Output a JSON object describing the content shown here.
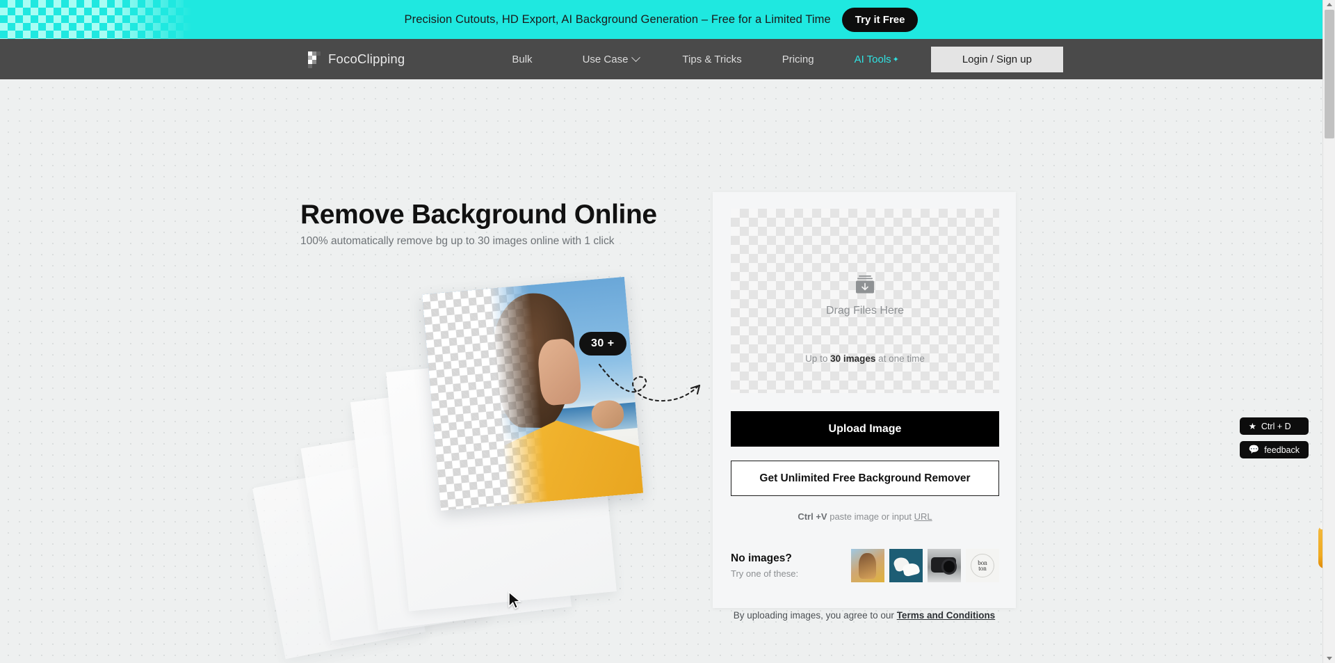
{
  "promo": {
    "text": "Precision Cutouts, HD Export, AI Background Generation – Free for a Limited Time",
    "cta_label": "Try it Free",
    "bg_color": "#1fe8e0"
  },
  "nav": {
    "brand": "FocoClipping",
    "brand_icon": "checkerboard-logo-icon",
    "items": [
      {
        "label": "Bulk",
        "has_chevron": false
      },
      {
        "label": "Use Case",
        "has_chevron": true
      },
      {
        "label": "Tips & Tricks",
        "has_chevron": false
      },
      {
        "label": "Pricing",
        "has_chevron": false
      }
    ],
    "ai_tools": {
      "label": "AI Tools",
      "color": "#2fe3e3",
      "sparkle_icon": "sparkle-icon"
    },
    "login_label": "Login / Sign up",
    "bg_color": "#4a4a4a"
  },
  "hero": {
    "title": "Remove Background Online",
    "subtitle": "100% automatically remove bg up to 30 images online with 1 click",
    "badge": "30 +",
    "cursor_icon": "cursor-arrow-icon",
    "arrow_icon": "dashed-curved-arrow-icon"
  },
  "upload": {
    "dropzone": {
      "icon": "upload-tray-icon",
      "label": "Drag Files Here",
      "limit_prefix": "Up to ",
      "limit_strong": "30 images",
      "limit_suffix": " at one time"
    },
    "upload_button": "Upload Image",
    "unlimited_button": "Get Unlimited Free Background Remover",
    "paste_hint": {
      "shortcut": "Ctrl +V",
      "text": " paste image or input ",
      "link": "URL"
    },
    "samples": {
      "title": "No images?",
      "subtitle": "Try one of these:",
      "items": [
        {
          "name": "sample-woman-beach"
        },
        {
          "name": "sample-sneakers"
        },
        {
          "name": "sample-camera"
        },
        {
          "name": "sample-bonton-logo",
          "text_top": "bon",
          "text_bottom": "ton"
        }
      ]
    },
    "terms": {
      "prefix": "By uploading images, you agree to our ",
      "link": "Terms and Conditions"
    }
  },
  "widgets": {
    "bookmark": {
      "icon": "star-icon",
      "label": "Ctrl + D"
    },
    "feedback": {
      "icon": "speech-bubble-icon",
      "label": "feedback"
    },
    "side_tab": {
      "name": "orange-side-tab"
    }
  }
}
